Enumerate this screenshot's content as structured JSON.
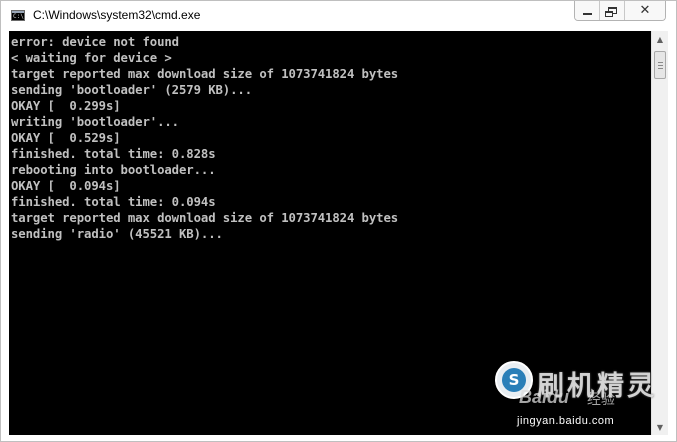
{
  "window": {
    "title": "C:\\Windows\\system32\\cmd.exe",
    "icon": "cmd-icon",
    "icon_glyph": "C:\\",
    "controls": {
      "minimize": "minimize-icon",
      "maximize": "restore-icon",
      "close_glyph": "✕"
    }
  },
  "console": {
    "background": "#000000",
    "foreground": "#c0c0c0",
    "lines": [
      "error: device not found",
      "< waiting for device >",
      "target reported max download size of 1073741824 bytes",
      "sending 'bootloader' (2579 KB)...",
      "OKAY [  0.299s]",
      "writing 'bootloader'...",
      "OKAY [  0.529s]",
      "finished. total time: 0.828s",
      "rebooting into bootloader...",
      "OKAY [  0.094s]",
      "finished. total time: 0.094s",
      "target reported max download size of 1073741824 bytes",
      "sending 'radio' (45521 KB)..."
    ]
  },
  "scrollbar": {
    "up_arrow": "▲",
    "down_arrow": "▼"
  },
  "watermark": {
    "brand": "刷机精灵",
    "logo_glyph": "S",
    "baidu": "Baidu",
    "experience": "经验",
    "url": "jingyan.baidu.com"
  }
}
